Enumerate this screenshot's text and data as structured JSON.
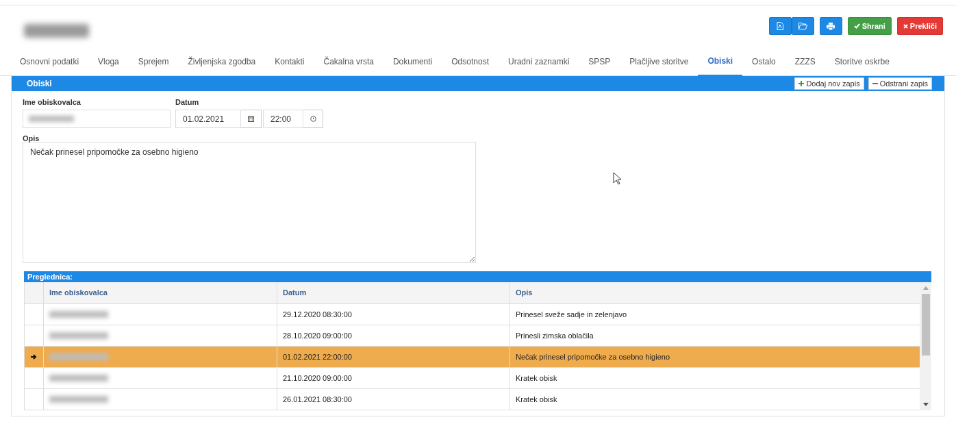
{
  "toolbar": {
    "icon_buttons": [
      {
        "kind": "pdf"
      },
      {
        "kind": "folder"
      },
      {
        "kind": "print"
      }
    ],
    "save": "Shrani",
    "cancel": "Prekliči"
  },
  "tabs": [
    {
      "label": "Osnovni podatki",
      "selected": false
    },
    {
      "label": "Vloga",
      "selected": false
    },
    {
      "label": "Sprejem",
      "selected": false
    },
    {
      "label": "Življenjska zgodba",
      "selected": false
    },
    {
      "label": "Kontakti",
      "selected": false
    },
    {
      "label": "Čakalna vrsta",
      "selected": false
    },
    {
      "label": "Dokumenti",
      "selected": false
    },
    {
      "label": "Odsotnost",
      "selected": false
    },
    {
      "label": "Uradni zaznamki",
      "selected": false
    },
    {
      "label": "SPSP",
      "selected": false
    },
    {
      "label": "Plačljive storitve",
      "selected": false
    },
    {
      "label": "Obiski",
      "selected": true
    },
    {
      "label": "Ostalo",
      "selected": false
    },
    {
      "label": "ZZZS",
      "selected": false
    },
    {
      "label": "Storitve oskrbe",
      "selected": false
    }
  ],
  "panel": {
    "title": "Obiski",
    "add_button": "Dodaj nov zapis",
    "remove_button": "Odstrani zapis"
  },
  "form": {
    "visitor_label": "Ime obiskovalca",
    "date_label": "Datum",
    "date_value": "01.02.2021",
    "time_value": "22:00",
    "description_label": "Opis",
    "description_value": "Nečak prinesel pripomočke za osebno higieno"
  },
  "grid": {
    "title": "Preglednica:",
    "columns": [
      "Ime obiskovalca",
      "Datum",
      "Opis"
    ],
    "rows": [
      {
        "datum": "29.12.2020 08:30:00",
        "opis": "Prinesel sveže sadje in zelenjavo",
        "selected": false
      },
      {
        "datum": "28.10.2020 09:00:00",
        "opis": "Prinesli zimska oblačila",
        "selected": false
      },
      {
        "datum": "01.02.2021 22:00:00",
        "opis": "Nečak prinesel pripomočke za osebno higieno",
        "selected": true
      },
      {
        "datum": "21.10.2020 09:00:00",
        "opis": "Kratek obisk",
        "selected": false
      },
      {
        "datum": "26.01.2021 08:30:00",
        "opis": "Kratek obisk",
        "selected": false
      }
    ]
  }
}
